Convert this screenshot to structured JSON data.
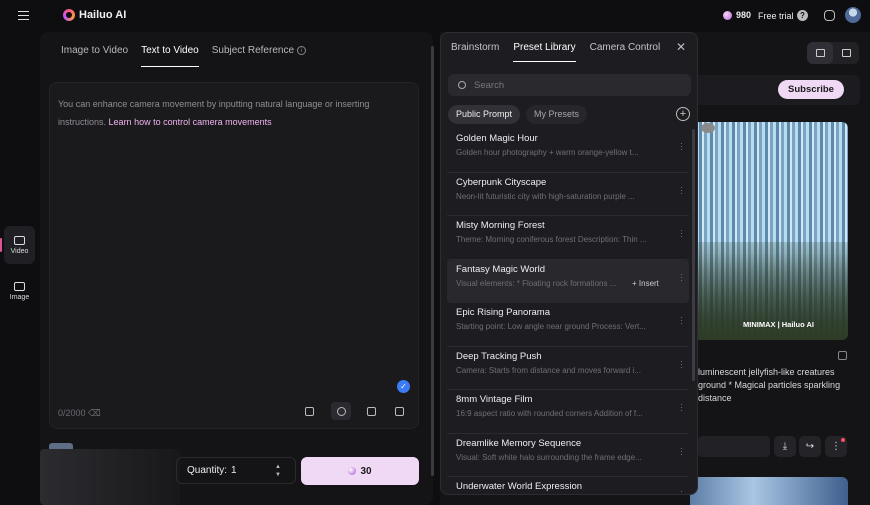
{
  "app": {
    "name": "Hailuo AI"
  },
  "header": {
    "credits": "980",
    "free_trial": "Free trial"
  },
  "rail": {
    "video": "Video",
    "image": "Image"
  },
  "tabs": [
    {
      "label": "Image to Video"
    },
    {
      "label": "Text to Video"
    },
    {
      "label": "Subject Reference"
    }
  ],
  "editor": {
    "hint": "You can enhance camera movement by inputting natural language or inserting instructions.",
    "hint_link": "Learn how to control camera movements",
    "counter": "0/2000"
  },
  "generate": {
    "quantity_label": "Quantity:",
    "quantity_value": "1",
    "cost": "30"
  },
  "popover": {
    "tabs": [
      {
        "label": "Brainstorm"
      },
      {
        "label": "Preset Library"
      },
      {
        "label": "Camera Control"
      }
    ],
    "search_placeholder": "Search",
    "chips": [
      {
        "label": "Public Prompt"
      },
      {
        "label": "My Presets"
      }
    ],
    "insert_label": "+ Insert",
    "presets": [
      {
        "title": "Golden Magic Hour",
        "desc": "Golden hour photography + warm orange-yellow t..."
      },
      {
        "title": "Cyberpunk Cityscape",
        "desc": "Neon-lit futuristic city with high-saturation purple ..."
      },
      {
        "title": "Misty Morning Forest",
        "desc": "Theme: Morning coniferous forest Description: Thin ..."
      },
      {
        "title": "Fantasy Magic World",
        "desc": "Visual elements: * Floating rock formations ..."
      },
      {
        "title": "Epic Rising Panorama",
        "desc": "Starting point: Low angle near ground Process: Vert..."
      },
      {
        "title": "Deep Tracking Push",
        "desc": "Camera: Starts from distance and moves forward i..."
      },
      {
        "title": "8mm Vintage Film",
        "desc": "16:9 aspect ratio with rounded corners Addition of f..."
      },
      {
        "title": "Dreamlike Memory Sequence",
        "desc": "Visual: Soft white halo surrounding the frame edge..."
      },
      {
        "title": "Underwater World Expression",
        "desc": ""
      }
    ]
  },
  "right": {
    "subscribe": "Subscribe",
    "watermark": "MINIMAX | Hailuo AI",
    "description": "luminescent jellyfish-like creatures ground * Magical particles sparkling distance"
  },
  "colors": {
    "accent": "#f0d9f4",
    "background": "#0e0e10",
    "check": "#3b7bf5"
  }
}
